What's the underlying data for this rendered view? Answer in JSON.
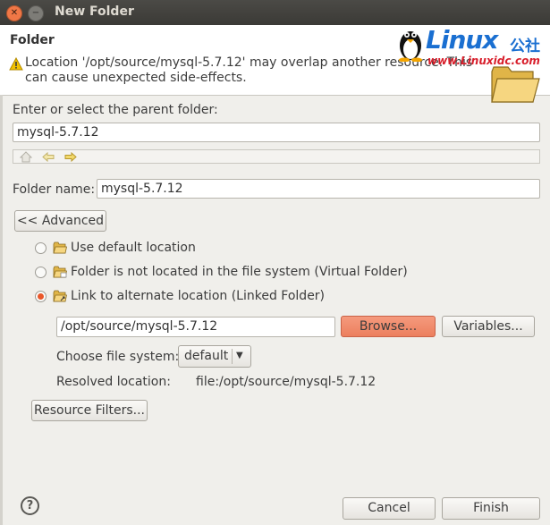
{
  "window": {
    "title": "New Folder"
  },
  "header": {
    "heading": "Folder",
    "warning": "Location '/opt/source/mysql-5.7.12' may overlap another resource. This can cause unexpected side-effects.",
    "logo": {
      "main": "Linux",
      "cn": "公社",
      "url": "www.Linuxidc.com"
    }
  },
  "parent": {
    "label": "Enter or select the parent folder:",
    "value": "mysql-5.7.12"
  },
  "folder_name": {
    "label": "Folder name:",
    "value": "mysql-5.7.12"
  },
  "advanced_button": "<< Advanced",
  "options": [
    {
      "label": "Use default location",
      "selected": false
    },
    {
      "label": "Folder is not located in the file system (Virtual Folder)",
      "selected": false
    },
    {
      "label": "Link to alternate location (Linked Folder)",
      "selected": true
    }
  ],
  "linked": {
    "path": "/opt/source/mysql-5.7.12",
    "browse": "Browse...",
    "variables": "Variables..."
  },
  "filesystem": {
    "label": "Choose file system:",
    "value": "default"
  },
  "resolved": {
    "label": "Resolved location:",
    "value": "file:/opt/source/mysql-5.7.12"
  },
  "resource_filters": "Resource Filters...",
  "footer": {
    "help": "?",
    "cancel": "Cancel",
    "finish": "Finish"
  },
  "colors": {
    "accent": "#ec7f5e",
    "radio_selected": "#e9572a",
    "title_bar": "#3b3a36"
  }
}
